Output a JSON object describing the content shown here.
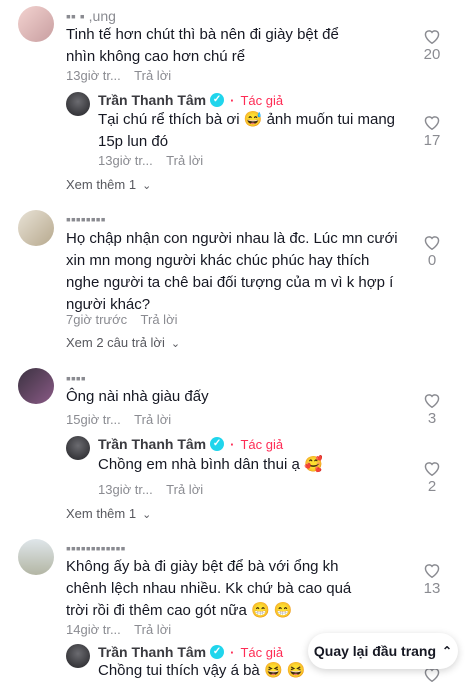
{
  "comments": [
    {
      "user": "▪▪ ▪ ,ung",
      "text": "Tinh tế hơn chút thì bà nên đi giày bệt để nhìn không cao hơn chú rể",
      "time": "13giờ tr...",
      "reply_label": "Trả lời",
      "likes": "20",
      "reply": {
        "user": "Trần Thanh Tâm",
        "badge": "Tác giả",
        "text": "Tại chú rể thích bà ơi 😅 ảnh muốn tui mang 15p lun đó",
        "time": "13giờ tr...",
        "reply_label": "Trả lời",
        "likes": "17"
      },
      "more": "Xem thêm 1"
    },
    {
      "user": "▪▪▪▪▪▪▪▪",
      "text": "Họ chập nhận con người nhau là đc. Lúc mn cưới xin mn mong người khác chúc phúc hay thích nghe người ta chê bai đối tượng của m vì k hợp í người khác?",
      "time": "7giờ trước",
      "reply_label": "Trả lời",
      "likes": "0",
      "more": "Xem 2 câu trả lời"
    },
    {
      "user": "▪▪▪▪",
      "text": "Ông nài nhà giàu đấy",
      "time": "15giờ tr...",
      "reply_label": "Trả lời",
      "likes": "3",
      "reply": {
        "user": "Trần Thanh Tâm",
        "badge": "Tác giả",
        "text": "Chồng em nhà bình dân thui ạ 🥰",
        "time": "13giờ tr...",
        "reply_label": "Trả lời",
        "likes": "2"
      },
      "more": "Xem thêm 1"
    },
    {
      "user": "▪▪▪▪▪▪▪▪▪▪▪▪",
      "text": "Không ấy bà đi giày bệt để bà với ổng kh chênh lệch nhau nhiều. Kk chứ bà cao quá trời rồi đi thêm cao gót nữa 😁 😁",
      "time": "14giờ tr...",
      "reply_label": "Trả lời",
      "likes": "13",
      "reply": {
        "user": "Trần Thanh Tâm",
        "badge": "Tác giả",
        "text": "Chồng tui thích vậy á bà 😆 😆",
        "time": "",
        "reply_label": "",
        "likes": ""
      }
    }
  ],
  "back_to_top": "Quay lại đầu trang",
  "colors": {
    "author": "#fe2c55",
    "verified": "#20d5ec",
    "muted": "#8a8b91"
  }
}
